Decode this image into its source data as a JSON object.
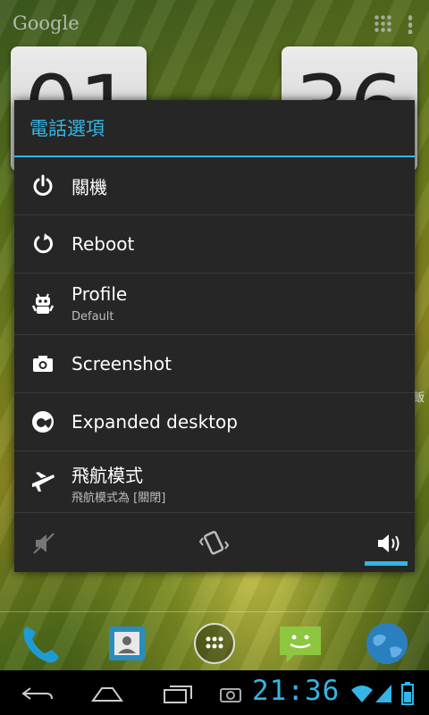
{
  "wallpaper": {
    "google_label": "Google",
    "clock_hour_digits": "01",
    "clock_min_digits": "36",
    "side_text": "有飯"
  },
  "dialog": {
    "title": "電話選項",
    "items": [
      {
        "icon": "power-icon",
        "label": "關機"
      },
      {
        "icon": "reboot-icon",
        "label": "Reboot"
      },
      {
        "icon": "profile-android-icon",
        "label": "Profile",
        "sub": "Default"
      },
      {
        "icon": "camera-icon",
        "label": "Screenshot"
      },
      {
        "icon": "expanded-desktop-icon",
        "label": "Expanded desktop"
      },
      {
        "icon": "airplane-icon",
        "label": "飛航模式",
        "sub": "飛航模式為 [關閉]"
      }
    ],
    "sound_modes": [
      "silent",
      "vibrate",
      "sound"
    ],
    "selected_sound_mode": "sound"
  },
  "dock": {
    "items": [
      "phone-icon",
      "contacts-icon",
      "app-drawer-icon",
      "messaging-icon",
      "browser-globe-icon"
    ]
  },
  "status": {
    "time": "21:36"
  },
  "colors": {
    "accent": "#33b5e5",
    "dialog_bg": "#262626"
  }
}
